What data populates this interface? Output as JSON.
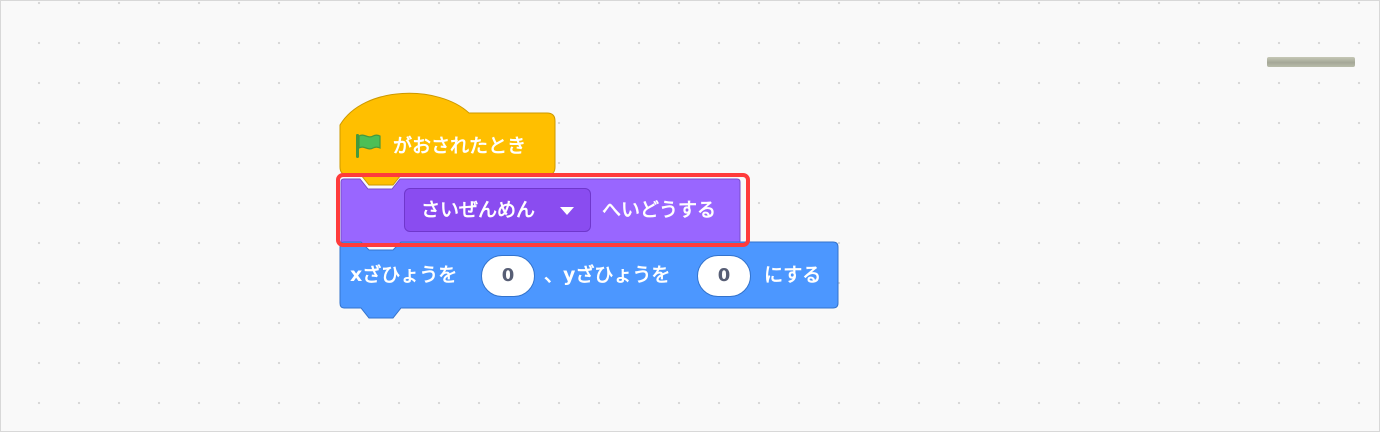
{
  "workspace": {
    "dot_grid_color": "#d6d6d6",
    "background_color": "#f9f9f9"
  },
  "script": {
    "hat_block": {
      "icon": "green-flag-icon",
      "label": "がおされたとき",
      "color": "#ffbf00"
    },
    "point_towards_block": {
      "dropdown_value": "さいぜんめん",
      "label": "へいどうする",
      "color": "#9966ff",
      "highlighted": true,
      "highlight_color": "#ff3b3b"
    },
    "goto_xy_block": {
      "x_label": "xざひょうを",
      "x_value": "0",
      "separator_label": "、yざひょうを",
      "y_value": "0",
      "suffix_label": "にする",
      "color": "#4c97ff"
    }
  }
}
